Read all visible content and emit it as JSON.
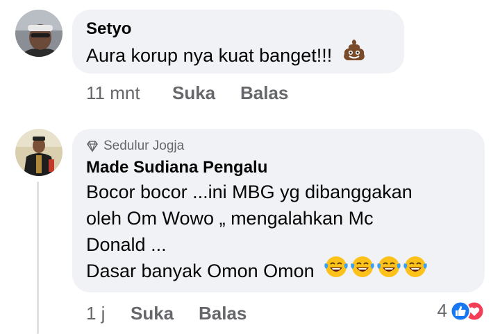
{
  "comments": [
    {
      "author": "Setyo",
      "text_lines": [
        "Aura korup nya kuat banget!!!"
      ],
      "trailing_emoji": [
        "pile-of-poo-icon"
      ],
      "time": "11 mnt",
      "like_label": "Suka",
      "reply_label": "Balas"
    },
    {
      "badge": "Sedulur Jogja",
      "badge_icon": "diamond-icon",
      "author": "Made Sudiana Pengalu",
      "text_lines": [
        "Bocor bocor ...ini MBG yg dibanggakan",
        "oleh Om Wowo „ mengalahkan Mc",
        "Donald ...",
        "Dasar banyak Omon Omon"
      ],
      "trailing_emoji": [
        "tears-of-joy-icon",
        "tears-of-joy-icon",
        "tears-of-joy-icon",
        "tears-of-joy-icon"
      ],
      "time": "1 j",
      "like_label": "Suka",
      "reply_label": "Balas",
      "reaction_count": "4",
      "reaction_icons": [
        "like-icon",
        "love-icon"
      ]
    }
  ],
  "colors": {
    "bubble": "#f0f2f5",
    "meta_text": "#65676b",
    "like_blue": "#1877f2",
    "love_red": "#f33e58"
  }
}
